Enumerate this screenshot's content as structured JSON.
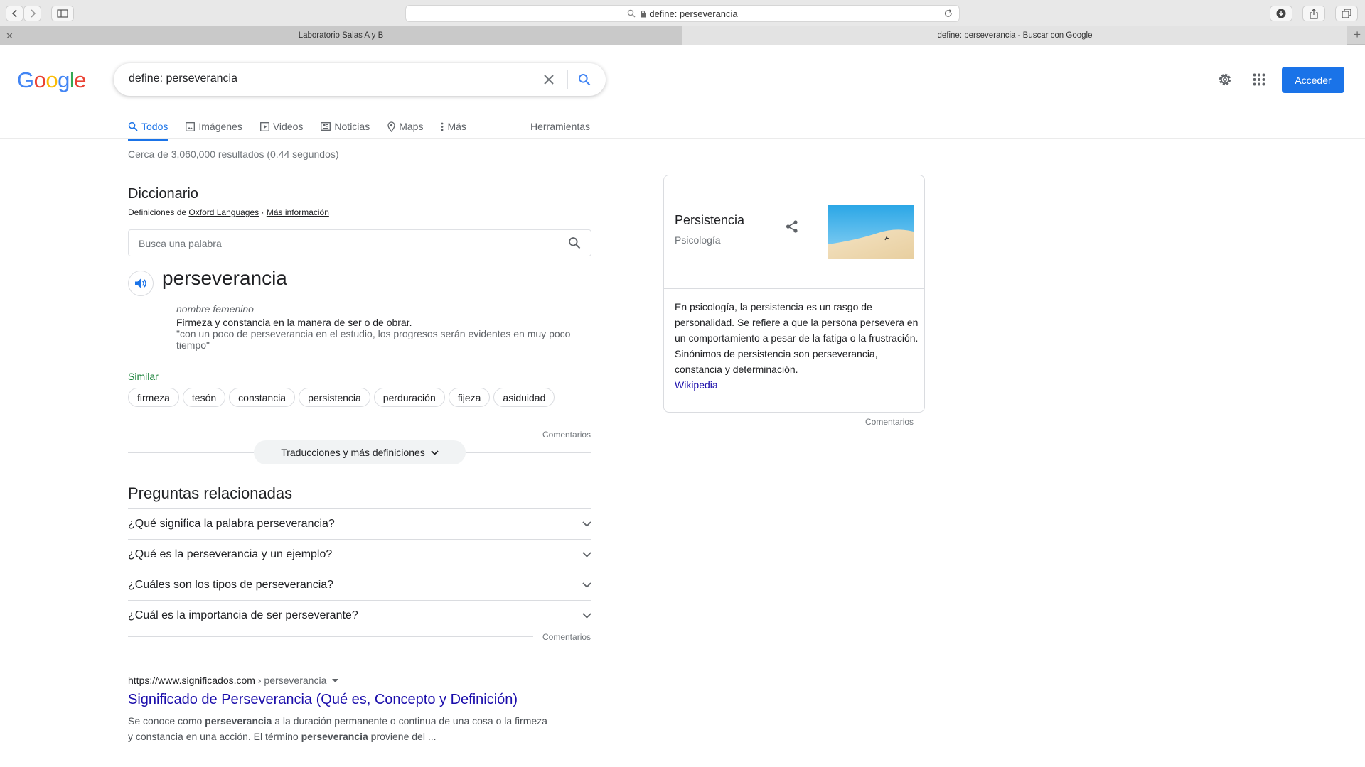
{
  "browser": {
    "address": "define: perseverancia",
    "tabs": [
      {
        "label": "Laboratorio Salas A y B"
      },
      {
        "label": "define: perseverancia - Buscar con Google"
      }
    ]
  },
  "google": {
    "logo_letters": [
      "G",
      "o",
      "o",
      "g",
      "l",
      "e"
    ],
    "query": "define: perseverancia",
    "signin_label": "Acceder",
    "nav": [
      {
        "label": "Todos",
        "icon": "search-icon"
      },
      {
        "label": "Imágenes",
        "icon": "image-icon"
      },
      {
        "label": "Videos",
        "icon": "video-icon"
      },
      {
        "label": "Noticias",
        "icon": "news-icon"
      },
      {
        "label": "Maps",
        "icon": "map-pin-icon"
      },
      {
        "label": "Más",
        "icon": "more-vert-icon"
      }
    ],
    "tools_label": "Herramientas",
    "stats": "Cerca de 3,060,000 resultados (0.44 segundos)"
  },
  "dictionary": {
    "title": "Diccionario",
    "source_prefix": "Definiciones de",
    "source_name": "Oxford Languages",
    "more_info": "Más información",
    "search_placeholder": "Busca una palabra",
    "word": "perseverancia",
    "part_of_speech": "nombre femenino",
    "definition": "Firmeza y constancia en la manera de ser o de obrar.",
    "example": "\"con un poco de perseverancia en el estudio, los progresos serán evidentes en muy poco tiempo\"",
    "similar_label": "Similar",
    "similar": [
      "firmeza",
      "tesón",
      "constancia",
      "persistencia",
      "perduración",
      "fijeza",
      "asiduidad"
    ],
    "feedback": "Comentarios",
    "translations_label": "Traducciones y más definiciones"
  },
  "related": {
    "title": "Preguntas relacionadas",
    "questions": [
      "¿Qué significa la palabra perseverancia?",
      "¿Qué es la perseverancia y un ejemplo?",
      "¿Cuáles son los tipos de perseverancia?",
      "¿Cuál es la importancia de ser perseverante?"
    ],
    "feedback": "Comentarios"
  },
  "result": {
    "url": "https://www.significados.com",
    "crumb": "› perseverancia",
    "title": "Significado de Perseverancia (Qué es, Concepto y Definición)",
    "snippet_1": "Se conoce como ",
    "snippet_b1": "perseverancia",
    "snippet_2": " a la duración permanente o continua de una cosa o la firmeza y constancia en una acción. El término ",
    "snippet_b2": "perseverancia",
    "snippet_3": " proviene del ..."
  },
  "knowledge_panel": {
    "title": "Persistencia",
    "subtitle": "Psicología",
    "description": "En psicología, la persistencia es un rasgo de personalidad. Se refiere a que la persona persevera en un comportamiento a pesar de la fatiga o la frustración. Sinónimos de persistencia son perseverancia,  constancia y determinación.",
    "link": "Wikipedia",
    "feedback": "Comentarios"
  },
  "colors": {
    "link": "#1a0dab",
    "accent": "#1a73e8",
    "similar": "#188038"
  }
}
